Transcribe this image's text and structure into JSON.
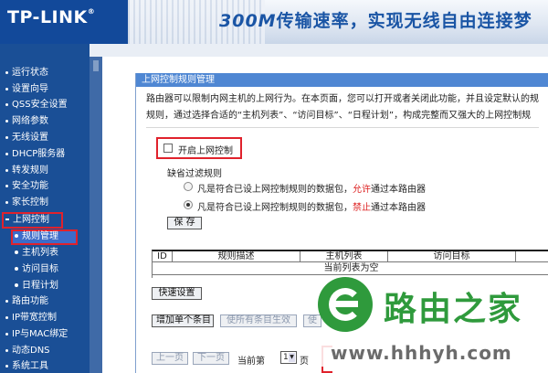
{
  "header": {
    "logo": "TP-LINK",
    "logo_mark": "®",
    "banner_speed": "300M",
    "banner_text": "传输速率，实现无线自由连接梦"
  },
  "sidebar": {
    "items": [
      {
        "label": "运行状态"
      },
      {
        "label": "设置向导"
      },
      {
        "label": "QSS安全设置"
      },
      {
        "label": "网络参数"
      },
      {
        "label": "无线设置"
      },
      {
        "label": "DHCP服务器"
      },
      {
        "label": "转发规则"
      },
      {
        "label": "安全功能"
      },
      {
        "label": "家长控制"
      },
      {
        "label": "上网控制",
        "active": true
      },
      {
        "label": "规则管理",
        "sub": true,
        "active": true
      },
      {
        "label": "主机列表",
        "sub": true
      },
      {
        "label": "访问目标",
        "sub": true
      },
      {
        "label": "日程计划",
        "sub": true
      },
      {
        "label": "路由功能"
      },
      {
        "label": "IP带宽控制"
      },
      {
        "label": "IP与MAC绑定"
      },
      {
        "label": "动态DNS"
      },
      {
        "label": "系统工具"
      }
    ]
  },
  "panel": {
    "title": "上网控制规则管理",
    "desc_line1": "路由器可以限制内网主机的上网行为。在本页面，您可以打开或者关闭此功能，并且设定默认的规",
    "desc_line2": "规则，通过选择合适的“主机列表”、“访问目标”、“日程计划”，构成完整而又强大的上网控制规",
    "enable_label": "开启上网控制",
    "enable_checked": false,
    "default_title": "缺省过滤规则",
    "rule_allow_prefix": "凡是符合已设上网控制规则的数据包，",
    "rule_allow_word": "允许",
    "rule_allow_suffix": "通过本路由器",
    "rule_deny_prefix": "凡是符合已设上网控制规则的数据包，",
    "rule_deny_word": "禁止",
    "rule_deny_suffix": "通过本路由器",
    "selected_rule": "deny",
    "save_label": "保 存",
    "table": {
      "columns": [
        "ID",
        "规则描述",
        "主机列表",
        "访问目标",
        ""
      ],
      "empty_text": "当前列表为空"
    },
    "quick_setup_label": "快速设置",
    "add_label": "增加单个条目",
    "disable_all_label": "使所有条目生效",
    "enable_all_label": "使",
    "prev_label": "上一页",
    "next_label": "下一页",
    "page_label": "当前第",
    "page_value": "1",
    "page_suffix": "页"
  },
  "watermark": {
    "name": "路由之家",
    "url": "www.hhhyh.com"
  }
}
